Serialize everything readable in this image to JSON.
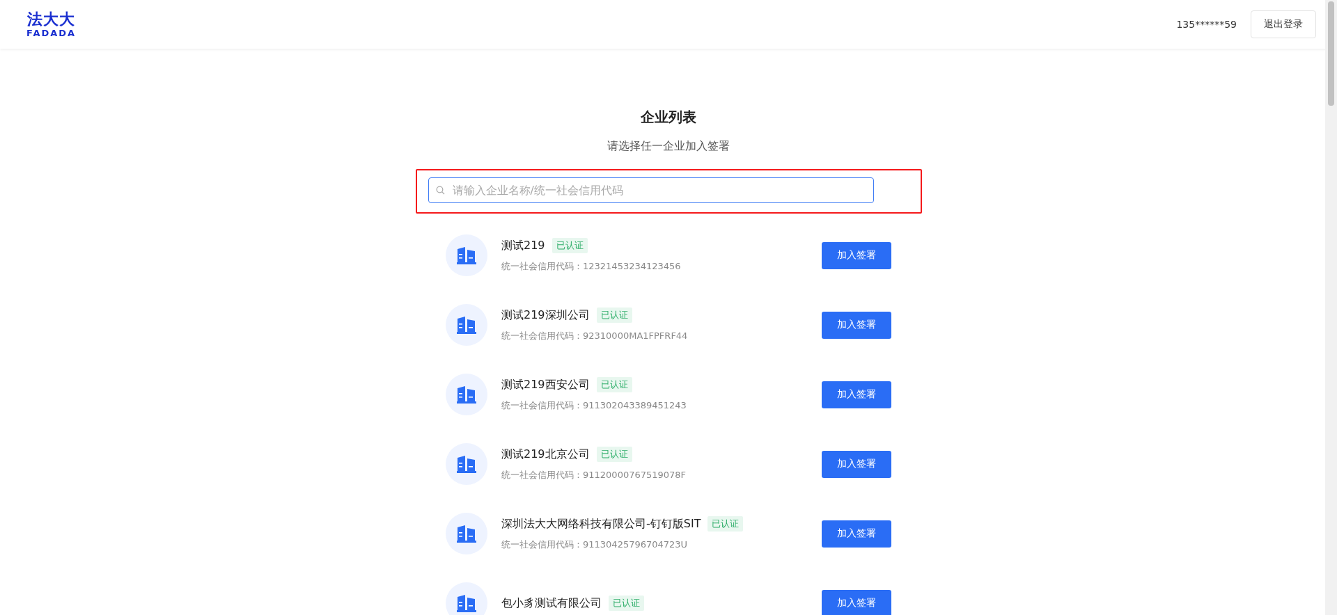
{
  "header": {
    "logo": {
      "cn": "法大大",
      "en": "FADADA"
    },
    "user": "135******59",
    "logout": "退出登录"
  },
  "page": {
    "title": "企业列表",
    "subtitle": "请选择任一企业加入签署"
  },
  "search": {
    "placeholder": "请输入企业名称/统一社会信用代码"
  },
  "companies": [
    {
      "name": "测试219",
      "tag": "已认证",
      "code": "统一社会信用代码：12321453234123456",
      "action": "加入签署"
    },
    {
      "name": "测试219深圳公司",
      "tag": "已认证",
      "code": "统一社会信用代码：92310000MA1FPFRF44",
      "action": "加入签署"
    },
    {
      "name": "测试219西安公司",
      "tag": "已认证",
      "code": "统一社会信用代码：911302043389451243",
      "action": "加入签署"
    },
    {
      "name": "测试219北京公司",
      "tag": "已认证",
      "code": "统一社会信用代码：91120000767519078F",
      "action": "加入签署"
    },
    {
      "name": "深圳法大大网络科技有限公司-钉钉版SIT",
      "tag": "已认证",
      "code": "统一社会信用代码：91130425796704723U",
      "action": "加入签署"
    },
    {
      "name": "包小豸测试有限公司",
      "tag": "已认证",
      "action": "加入签署"
    }
  ]
}
